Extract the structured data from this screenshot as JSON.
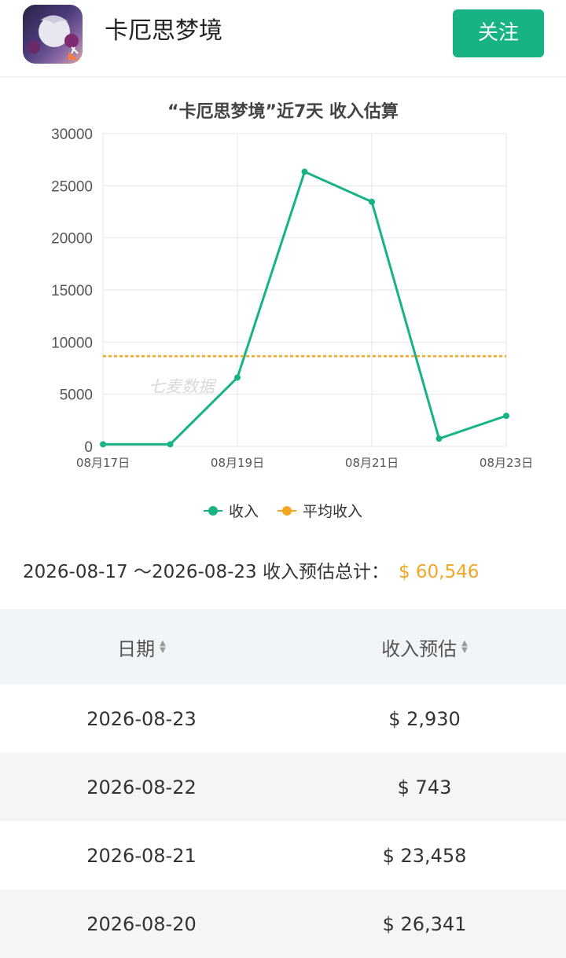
{
  "header": {
    "app_name": "卡厄思梦境",
    "follow_label": "关注"
  },
  "chart_title": "“卡厄思梦境”近7天 收入估算",
  "watermark": "七麦数据",
  "chart_data": {
    "type": "line",
    "x": [
      "08月17日",
      "08月18日",
      "08月19日",
      "08月20日",
      "08月21日",
      "08月22日",
      "08月23日"
    ],
    "x_tick_labels": [
      "08月17日",
      "08月19日",
      "08月21日",
      "08月23日"
    ],
    "series": [
      {
        "name": "收入",
        "values": [
          200,
          200,
          6600,
          26341,
          23458,
          743,
          2930
        ],
        "color": "#17b385"
      },
      {
        "name": "平均收入",
        "values": [
          8650,
          8650,
          8650,
          8650,
          8650,
          8650,
          8650
        ],
        "color": "#f5a623",
        "style": "dashed"
      }
    ],
    "ylim": [
      0,
      30000
    ],
    "y_ticks": [
      0,
      5000,
      10000,
      15000,
      20000,
      25000,
      30000
    ],
    "grid": true,
    "legend": "bottom-center"
  },
  "legend": [
    {
      "label": "收入",
      "color": "#17b385"
    },
    {
      "label": "平均收入",
      "color": "#f5a623"
    }
  ],
  "summary": {
    "label": "2026-08-17 ～2026-08-23 收入预估总计：",
    "amount": "$ 60,546"
  },
  "table": {
    "headers": [
      "日期",
      "收入预估"
    ],
    "rows": [
      [
        "2026-08-23",
        "$ 2,930"
      ],
      [
        "2026-08-22",
        "$ 743"
      ],
      [
        "2026-08-21",
        "$ 23,458"
      ],
      [
        "2026-08-20",
        "$ 26,341"
      ]
    ]
  }
}
